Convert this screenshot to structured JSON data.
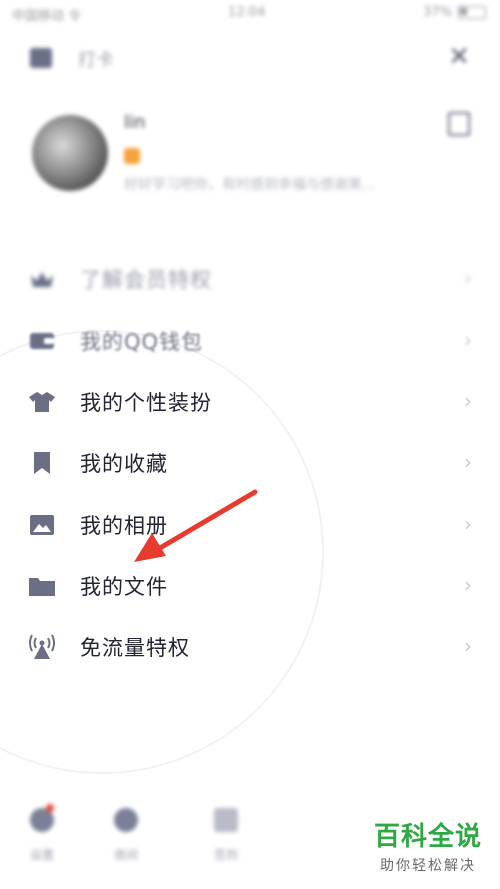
{
  "status_bar": {
    "carrier": "中国移动 令",
    "time": "12:04",
    "battery": "37%"
  },
  "header": {
    "title": "打卡"
  },
  "profile": {
    "username": "lin",
    "signature": "好好学习吧你，有时感到幸福与感谢美..."
  },
  "menu": {
    "items": [
      {
        "label": "了解会员特权",
        "icon": "crown-icon"
      },
      {
        "label": "我的QQ钱包",
        "icon": "wallet-icon"
      },
      {
        "label": "我的个性装扮",
        "icon": "tshirt-icon"
      },
      {
        "label": "我的收藏",
        "icon": "bookmark-icon"
      },
      {
        "label": "我的相册",
        "icon": "photo-icon"
      },
      {
        "label": "我的文件",
        "icon": "folder-icon"
      },
      {
        "label": "免流量特权",
        "icon": "antenna-icon"
      }
    ]
  },
  "bottom_bar": {
    "items": [
      {
        "label": "设置"
      },
      {
        "label": "夜间"
      },
      {
        "label": "签到"
      }
    ]
  },
  "watermark": {
    "main": "百科全说",
    "sub": "助你轻松解决"
  },
  "colors": {
    "accent_arrow": "#e63b2e",
    "icon": "#6a6f86",
    "watermark_green": "#2ea843"
  }
}
